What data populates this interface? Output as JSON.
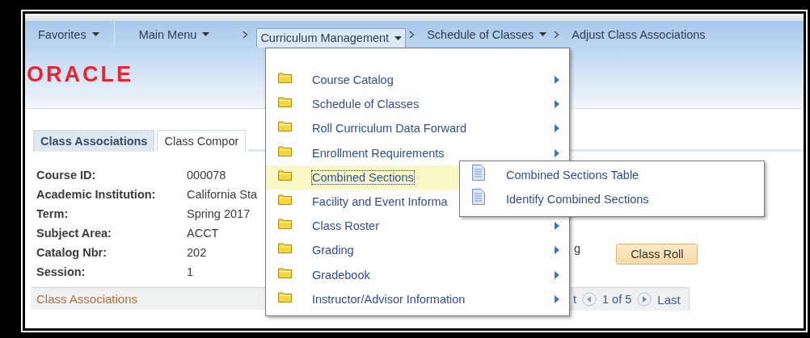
{
  "nav": [
    {
      "label": "Favorites",
      "caret": true,
      "separator_before": false,
      "selected": false,
      "divider_after": true
    },
    {
      "label": "Main Menu",
      "caret": true,
      "separator_before": false,
      "selected": false,
      "divider_after": false
    },
    {
      "label": "Curriculum Management",
      "caret": true,
      "separator_before": true,
      "selected": true,
      "divider_after": false
    },
    {
      "label": "Schedule of Classes",
      "caret": true,
      "separator_before": true,
      "selected": false,
      "divider_after": false
    },
    {
      "label": "Adjust Class Associations",
      "caret": false,
      "separator_before": true,
      "selected": false,
      "divider_after": false
    }
  ],
  "logo": "ORACLE",
  "tabs": [
    {
      "label": "Class Associations",
      "selected": true
    },
    {
      "label": "Class Compor",
      "selected": false
    }
  ],
  "fields": [
    {
      "label": "Course ID:",
      "value": "000078"
    },
    {
      "label": "Academic Institution:",
      "value": "California Sta"
    },
    {
      "label": "Term:",
      "value": "Spring 2017"
    },
    {
      "label": "Subject Area:",
      "value": "ACCT"
    },
    {
      "label": "Catalog Nbr:",
      "value": "202"
    },
    {
      "label": "Session:",
      "value": "1"
    }
  ],
  "partial_text": "g",
  "class_roll_button": "Class Roll",
  "section": {
    "title": "Class Associations",
    "pager": {
      "partial_text": "t",
      "range": "1 of 5",
      "last": "Last"
    }
  },
  "menu": [
    {
      "label": "Course Catalog",
      "arrow": true,
      "selected": false
    },
    {
      "label": "Schedule of Classes",
      "arrow": true,
      "selected": false
    },
    {
      "label": "Roll Curriculum Data Forward",
      "arrow": true,
      "selected": false
    },
    {
      "label": "Enrollment Requirements",
      "arrow": true,
      "selected": false
    },
    {
      "label": "Combined Sections",
      "selected": true
    },
    {
      "label": "Facility and Event Informa",
      "selected": false
    },
    {
      "label": "Class Roster",
      "arrow": true,
      "selected": false
    },
    {
      "label": "Grading",
      "arrow": true,
      "selected": false
    },
    {
      "label": "Gradebook",
      "arrow": true,
      "selected": false
    },
    {
      "label": "Instructor/Advisor Information",
      "arrow": true,
      "selected": false
    }
  ],
  "submenu": [
    {
      "label": "Combined Sections Table"
    },
    {
      "label": "Identify Combined Sections"
    }
  ]
}
